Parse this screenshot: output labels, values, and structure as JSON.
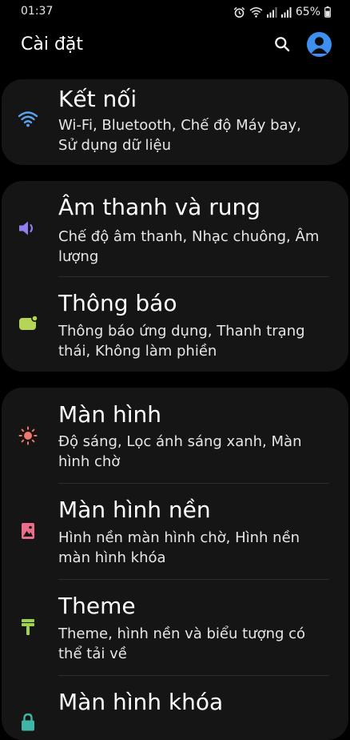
{
  "status": {
    "time": "01:37",
    "battery": "65%"
  },
  "header": {
    "title": "Cài đặt"
  },
  "settings": {
    "connections": {
      "title": "Kết nối",
      "subtitle": "Wi-Fi, Bluetooth, Chế độ Máy bay, Sử dụng dữ liệu",
      "icon": "wifi-icon",
      "color": "#5aa3ef"
    },
    "sound": {
      "title": "Âm thanh và rung",
      "subtitle": "Chế độ âm thanh, Nhạc chuông, Âm lượng",
      "icon": "speaker-icon",
      "color": "#8f7ff0"
    },
    "notifications": {
      "title": "Thông báo",
      "subtitle": "Thông báo ứng dụng, Thanh trạng thái, Không làm phiền",
      "icon": "notification-icon",
      "color": "#b6d556"
    },
    "display": {
      "title": "Màn hình",
      "subtitle": "Độ sáng, Lọc ánh sáng xanh, Màn hình chờ",
      "icon": "brightness-icon",
      "color": "#f0786a"
    },
    "wallpaper": {
      "title": "Màn hình nền",
      "subtitle": "Hình nền màn hình chờ, Hình nền màn hình khóa",
      "icon": "wallpaper-icon",
      "color": "#ec6d8a"
    },
    "theme": {
      "title": "Theme",
      "subtitle": "Theme, hình nền và biểu tượng có thể tải về",
      "icon": "paint-roller-icon",
      "color": "#9dd24f"
    },
    "lockscreen": {
      "title": "Màn hình khóa",
      "icon": "lock-icon",
      "color": "#3fb5a5"
    }
  }
}
